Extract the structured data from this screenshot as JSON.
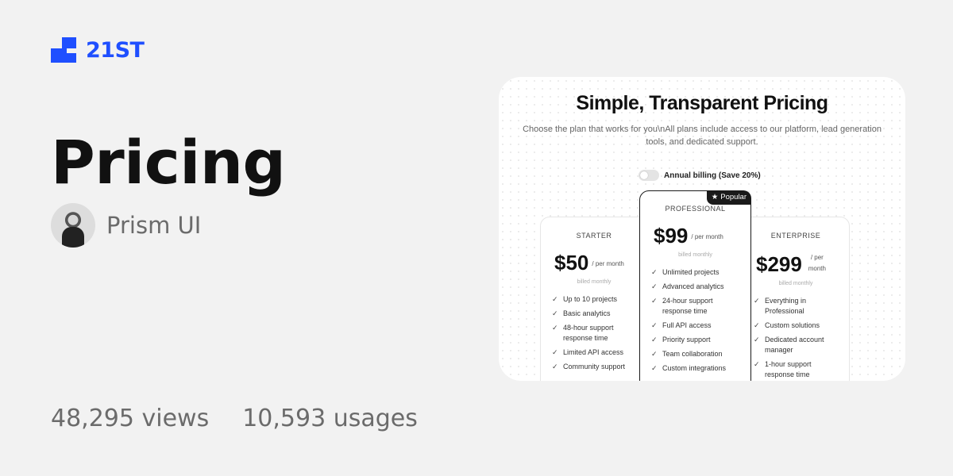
{
  "brand": {
    "name": "21ST",
    "color": "#1f4fff"
  },
  "component": {
    "title": "Pricing",
    "author": "Prism UI"
  },
  "stats": {
    "views": "48,295 views",
    "usages": "10,593 usages"
  },
  "preview": {
    "title": "Simple, Transparent Pricing",
    "subtitle": "Choose the plan that works for you\\nAll plans include access to our platform, lead generation tools, and dedicated support.",
    "billing_toggle": {
      "label": "Annual billing (Save 20%)",
      "on": false
    },
    "plans": [
      {
        "name": "STARTER",
        "price": "$50",
        "period": "/ per month",
        "billed": "billed monthly",
        "features": [
          "Up to 10 projects",
          "Basic analytics",
          "48-hour support response time",
          "Limited API access",
          "Community support"
        ]
      },
      {
        "name": "PROFESSIONAL",
        "badge": "Popular",
        "price": "$99",
        "period": "/ per month",
        "billed": "billed monthly",
        "features": [
          "Unlimited projects",
          "Advanced analytics",
          "24-hour support response time",
          "Full API access",
          "Priority support",
          "Team collaboration",
          "Custom integrations"
        ]
      },
      {
        "name": "ENTERPRISE",
        "price": "$299",
        "period": "/ per month",
        "billed": "billed monthly",
        "features": [
          "Everything in Professional",
          "Custom solutions",
          "Dedicated account manager",
          "1-hour support response time"
        ]
      }
    ]
  },
  "icons": {
    "logo": "21st-logo-icon",
    "check": "check-icon",
    "star": "star-icon"
  }
}
